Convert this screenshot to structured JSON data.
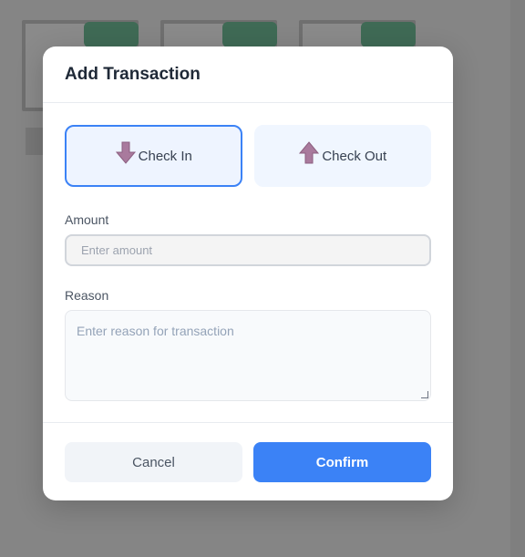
{
  "modal": {
    "title": "Add Transaction",
    "type_options": [
      {
        "label": "Check In",
        "icon": "arrow-down-icon",
        "selected": true
      },
      {
        "label": "Check Out",
        "icon": "arrow-up-icon",
        "selected": false
      }
    ],
    "amount": {
      "label": "Amount",
      "placeholder": "Enter amount",
      "value": ""
    },
    "reason": {
      "label": "Reason",
      "placeholder": "Enter reason for transaction",
      "value": ""
    },
    "buttons": {
      "cancel": "Cancel",
      "confirm": "Confirm"
    }
  },
  "colors": {
    "accent": "#3b82f6",
    "icon_fill": "#a97a9d",
    "backdrop": "#808080"
  }
}
